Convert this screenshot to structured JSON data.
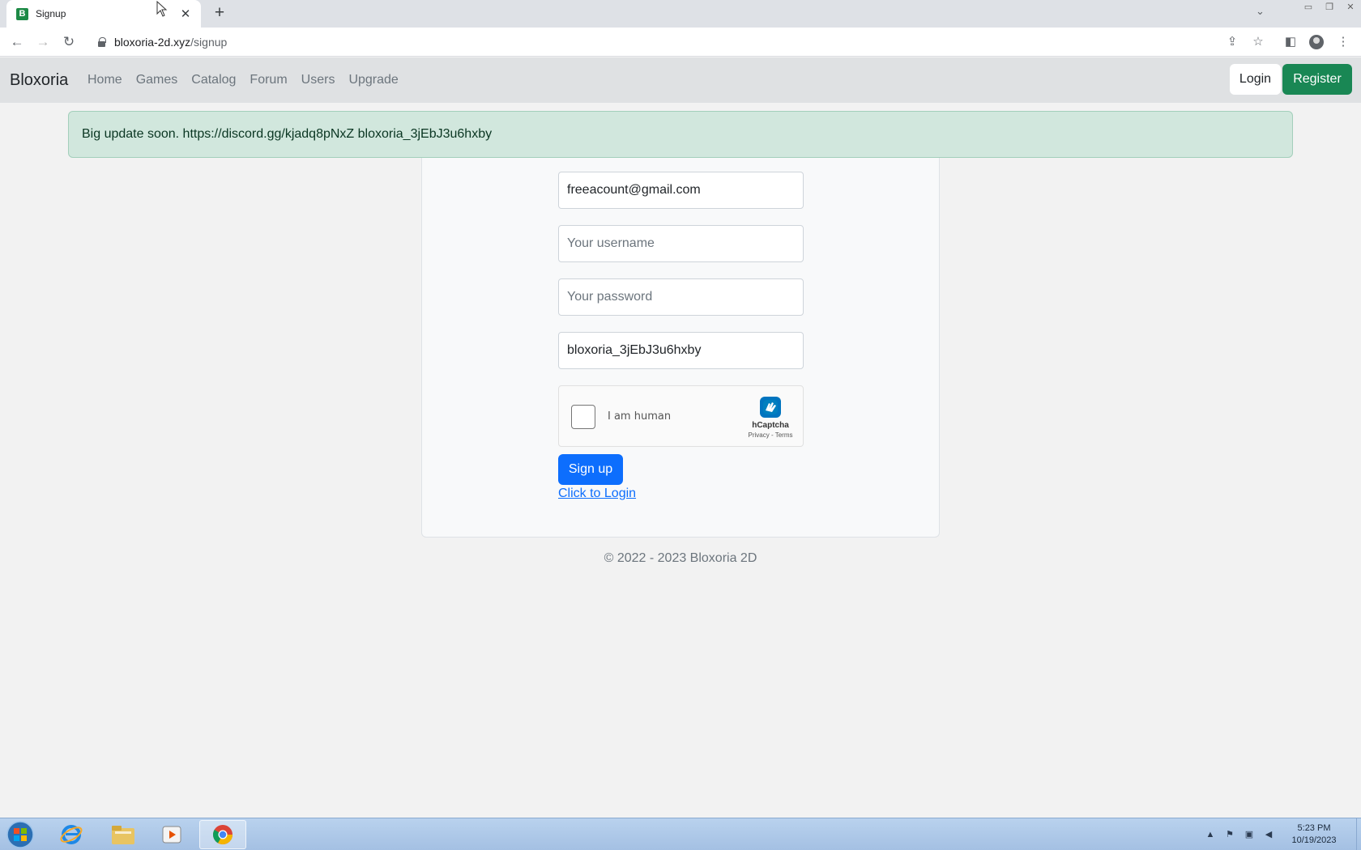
{
  "browser": {
    "tab_title": "Signup",
    "favicon_letter": "B",
    "url_host": "bloxoria-2d.xyz",
    "url_path": "/signup"
  },
  "navbar": {
    "brand": "Bloxoria",
    "links": [
      "Home",
      "Games",
      "Catalog",
      "Forum",
      "Users",
      "Upgrade"
    ],
    "login_label": "Login",
    "register_label": "Register"
  },
  "alert": {
    "text": "Big update soon. https://discord.gg/kjadq8pNxZ bloxoria_3jEbJ3u6hxby"
  },
  "form": {
    "email_value": "freeacount@gmail.com",
    "username_placeholder": "Your username",
    "password_placeholder": "Your password",
    "code_value": "bloxoria_3jEbJ3u6hxby",
    "captcha_label": "I am human",
    "captcha_brand": "hCaptcha",
    "captcha_terms": "Privacy - Terms",
    "signup_label": "Sign up",
    "login_link": "Click to Login"
  },
  "footer": {
    "text": "© 2022 - 2023 Bloxoria 2D"
  },
  "taskbar": {
    "time": "5:23 PM",
    "date": "10/19/2023"
  },
  "colors": {
    "navbar_bg": "#dfe1e3",
    "alert_bg": "#d1e7dd",
    "register_green": "#198754",
    "primary_blue": "#0d6efd"
  }
}
